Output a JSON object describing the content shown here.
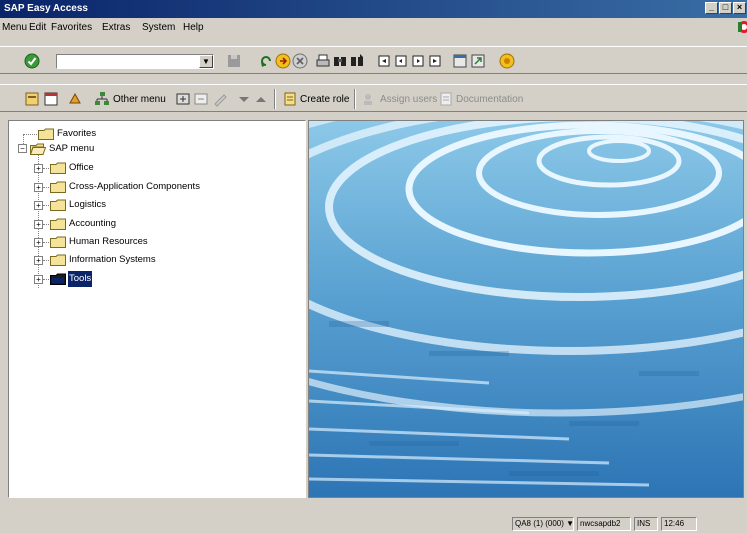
{
  "window": {
    "title": "SAP Easy Access",
    "controls": {
      "minimize": "_",
      "maximize": "□",
      "close": "×"
    }
  },
  "menubar": {
    "items": [
      "Menu",
      "Edit",
      "Favorites",
      "Extras",
      "System",
      "Help"
    ]
  },
  "standard_toolbar": {
    "command_field_value": "",
    "icons": [
      "enter-icon",
      "save-icon",
      "back-icon",
      "exit-icon",
      "cancel-icon",
      "print-icon",
      "find-icon",
      "find-next-icon",
      "first-page-icon",
      "previous-page-icon",
      "next-page-icon",
      "last-page-icon",
      "create-session-icon",
      "shortcut-icon",
      "help-icon"
    ]
  },
  "application_toolbar": {
    "other_menu": "Other menu",
    "create_role": "Create role",
    "assign_users": "Assign users",
    "documentation": "Documentation"
  },
  "tree": {
    "favorites": "Favorites",
    "sap_menu": "SAP menu",
    "children": [
      {
        "label": "Office"
      },
      {
        "label": "Cross-Application Components"
      },
      {
        "label": "Logistics"
      },
      {
        "label": "Accounting"
      },
      {
        "label": "Human Resources"
      },
      {
        "label": "Information Systems"
      },
      {
        "label": "Tools",
        "selected": true
      }
    ],
    "expand_symbol": "+",
    "collapse_symbol": "−"
  },
  "statusbar": {
    "system": "QA8 (1) (000)",
    "server": "nwcsapdb2",
    "mode": "INS",
    "time": "12:46"
  },
  "colors": {
    "title_bar": "#0a246a",
    "selection": "#0a246a",
    "folder": "#f6e39a",
    "background": "#d4d0c8"
  }
}
